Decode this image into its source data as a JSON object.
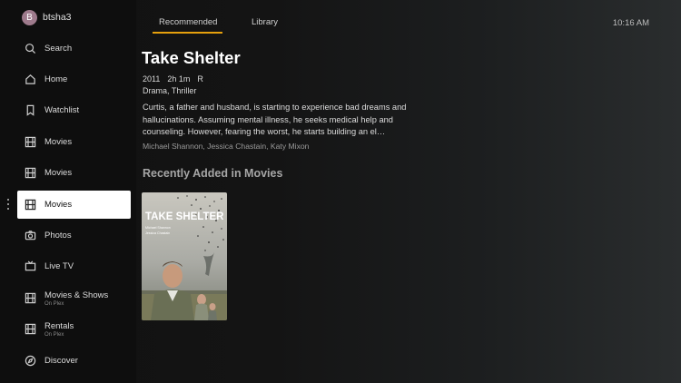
{
  "profile": {
    "initial": "B",
    "name": "btsha3"
  },
  "sidebar": {
    "items": [
      {
        "label": "Search",
        "sub": "",
        "icon": "search-icon"
      },
      {
        "label": "Home",
        "sub": "",
        "icon": "home-icon"
      },
      {
        "label": "Watchlist",
        "sub": "",
        "icon": "bookmark-icon"
      },
      {
        "label": "Movies",
        "sub": "",
        "icon": "film-icon"
      },
      {
        "label": "Movies",
        "sub": "",
        "icon": "film-icon"
      },
      {
        "label": "Movies",
        "sub": "",
        "icon": "film-icon",
        "active": true
      },
      {
        "label": "Photos",
        "sub": "",
        "icon": "camera-icon"
      },
      {
        "label": "Live TV",
        "sub": "",
        "icon": "tv-icon"
      },
      {
        "label": "Movies & Shows",
        "sub": "On Plex",
        "icon": "film-icon"
      },
      {
        "label": "Rentals",
        "sub": "On Plex",
        "icon": "film-icon"
      },
      {
        "label": "Discover",
        "sub": "",
        "icon": "compass-icon"
      }
    ]
  },
  "tabs": {
    "recommended": "Recommended",
    "library": "Library"
  },
  "clock": "10:16 AM",
  "featured": {
    "title": "Take Shelter",
    "year": "2011",
    "duration": "2h 1m",
    "rating": "R",
    "genres": "Drama, Thriller",
    "summary": "Curtis, a father and husband, is starting to experience bad dreams and hallucinations. Assuming mental illness, he seeks medical help and counseling. However, fearing the worst, he starts building an el…",
    "cast": "Michael Shannon, Jessica Chastain, Katy Mixon"
  },
  "section": {
    "title": "Recently Added in Movies"
  },
  "poster": {
    "title": "TAKE SHELTER",
    "credit1": "Michael Shannon",
    "credit2": "Jessica Chastain"
  },
  "colors": {
    "accent": "#e5a00d",
    "active_bg": "#ffffff",
    "avatar": "#9e7a8c"
  }
}
